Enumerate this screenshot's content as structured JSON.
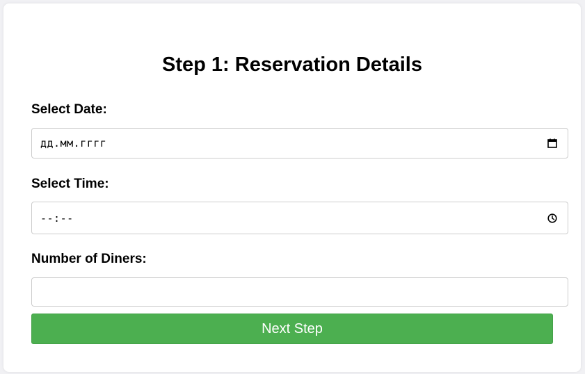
{
  "form": {
    "title": "Step 1: Reservation Details",
    "date": {
      "label": "Select Date:",
      "placeholder": "дд.мм.гггг",
      "icon": "calendar-icon"
    },
    "time": {
      "label": "Select Time:",
      "placeholder": "--:--",
      "icon": "clock-icon"
    },
    "diners": {
      "label": "Number of Diners:",
      "value": ""
    },
    "next_button_label": "Next Step"
  },
  "colors": {
    "page_background": "#f1f1f4",
    "card_background": "#ffffff",
    "button_background": "#4caf50",
    "button_text": "#ffffff",
    "input_border": "#cccccc"
  }
}
